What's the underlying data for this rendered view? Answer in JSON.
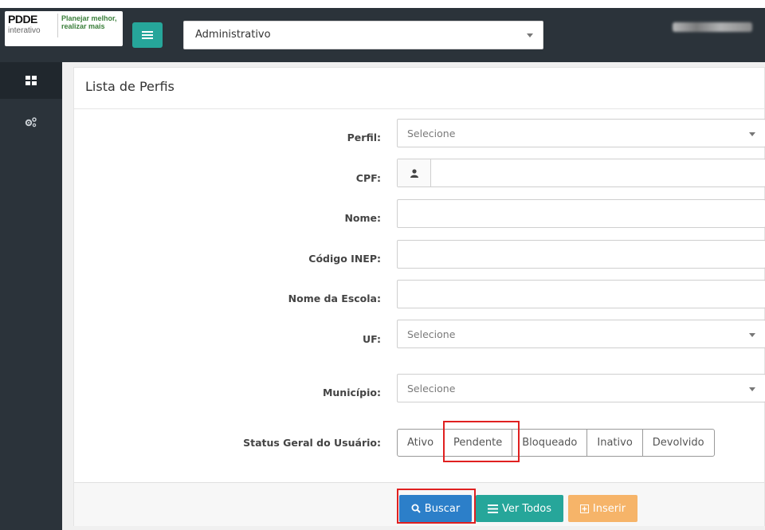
{
  "header": {
    "logo_title": "PDDE",
    "logo_subtitle": "interativo",
    "logo_tagline_1": "Planejar melhor,",
    "logo_tagline_2": "realizar mais",
    "context_select_value": "Administrativo",
    "user_name_redacted": true
  },
  "sidebar": {
    "items": [
      {
        "icon": "dashboard-grid-icon",
        "active": true
      },
      {
        "icon": "gears-icon",
        "active": false
      }
    ]
  },
  "page": {
    "title": "Lista de Perfis"
  },
  "form": {
    "perfil_label": "Perfil:",
    "perfil_value": "Selecione",
    "cpf_label": "CPF:",
    "cpf_value": "",
    "nome_label": "Nome:",
    "nome_value": "",
    "codigo_inep_label": "Código INEP:",
    "codigo_inep_value": "",
    "nome_escola_label": "Nome da Escola:",
    "nome_escola_value": "",
    "uf_label": "UF:",
    "uf_value": "Selecione",
    "municipio_label": "Município:",
    "municipio_value": "Selecione",
    "status_label": "Status Geral do Usuário:",
    "status_options": [
      "Ativo",
      "Pendente",
      "Bloqueado",
      "Inativo",
      "Devolvido"
    ]
  },
  "actions": {
    "buscar": "Buscar",
    "ver_todos": "Ver Todos",
    "inserir": "Inserir"
  },
  "colors": {
    "sidebar_bg": "#2b333a",
    "accent_teal": "#26a69a",
    "primary_blue": "#2c7fc9",
    "warning_orange": "#f6b469",
    "highlight_red": "#e02020"
  }
}
